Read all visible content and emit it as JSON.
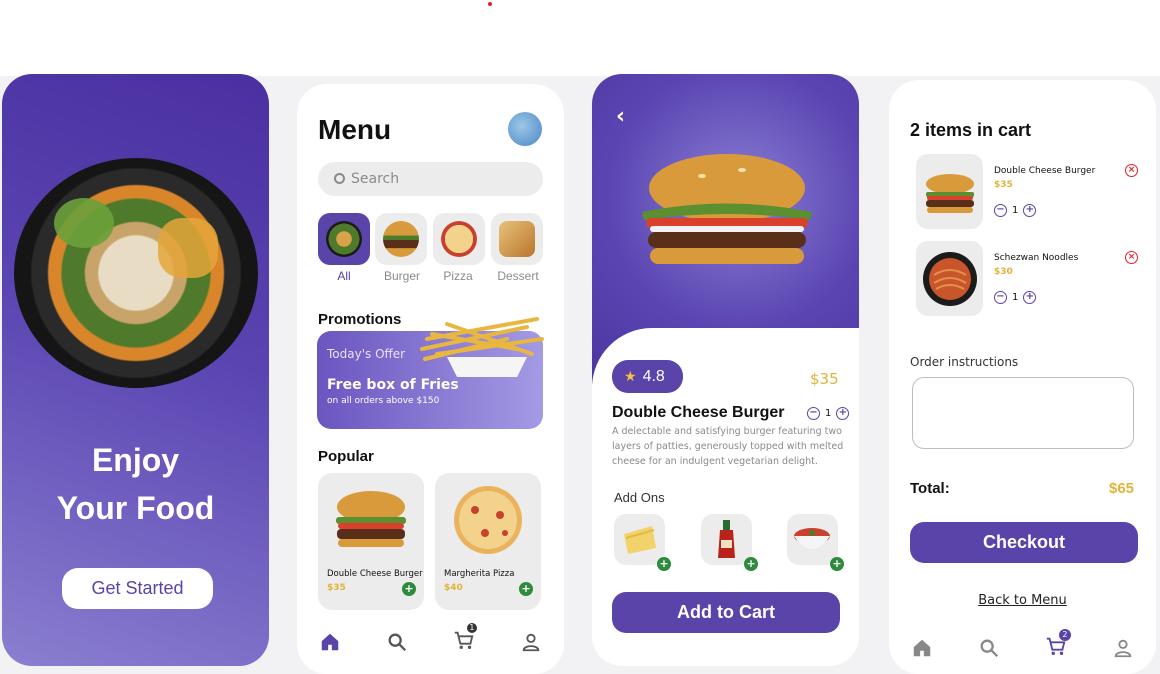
{
  "colors": {
    "brand": "#5a43a9",
    "price": "#e0b43a",
    "add": "#2e8b3e",
    "remove": "#e1202a"
  },
  "welcome": {
    "title_line1": "Enjoy",
    "title_line2": "Your Food",
    "cta_label": "Get Started"
  },
  "menu": {
    "title": "Menu",
    "search_placeholder": "Search",
    "categories": [
      {
        "label": "All",
        "active": true
      },
      {
        "label": "Burger",
        "active": false
      },
      {
        "label": "Pizza",
        "active": false
      },
      {
        "label": "Dessert",
        "active": false
      }
    ],
    "promotions_title": "Promotions",
    "promo": {
      "kicker": "Today's Offer",
      "headline": "Free box of Fries",
      "subline": "on all orders above $150"
    },
    "popular_title": "Popular",
    "popular": [
      {
        "name": "Double Cheese Burger",
        "price": "$35"
      },
      {
        "name": "Margherita Pizza",
        "price": "$40"
      }
    ],
    "nav": {
      "cart_badge": "1",
      "icons": [
        "home-icon",
        "search-icon",
        "cart-icon",
        "profile-icon"
      ]
    }
  },
  "detail": {
    "rating": "4.8",
    "price": "$35",
    "name": "Double Cheese Burger",
    "quantity": "1",
    "description": "A delectable and satisfying burger featuring two layers of patties, generously topped with melted cheese for an indulgent vegetarian delight.",
    "addons_title": "Add Ons",
    "addon_icons": [
      "cheese-slice-icon",
      "ketchup-bottle-icon",
      "salsa-bowl-icon"
    ],
    "cta_label": "Add to Cart"
  },
  "cart": {
    "title": "2 items in cart",
    "items": [
      {
        "name": "Double Cheese Burger",
        "price": "$35",
        "quantity": "1"
      },
      {
        "name": "Schezwan Noodles",
        "price": "$30",
        "quantity": "1"
      }
    ],
    "instructions_label": "Order instructions",
    "total_label": "Total:",
    "total_value": "$65",
    "checkout_label": "Checkout",
    "back_label": "Back to Menu",
    "nav": {
      "cart_badge": "2"
    }
  }
}
